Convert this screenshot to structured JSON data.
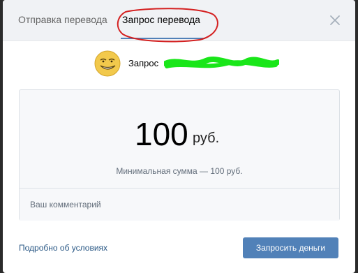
{
  "tabs": {
    "send_label": "Отправка перевода",
    "request_label": "Запрос перевода"
  },
  "recipient": {
    "label": "Запрос",
    "avatar_icon": "trollface-icon"
  },
  "amount": {
    "value": "100",
    "currency": "руб."
  },
  "min_sum": "Минимальная сумма — 100 руб.",
  "comment": {
    "placeholder": "Ваш комментарий"
  },
  "footer": {
    "terms_link": "Подробно об условиях",
    "request_button": "Запросить деньги"
  },
  "colors": {
    "accent": "#5181b8",
    "link": "#2a5885",
    "annotation": "#d42020",
    "redaction": "#19e619"
  }
}
